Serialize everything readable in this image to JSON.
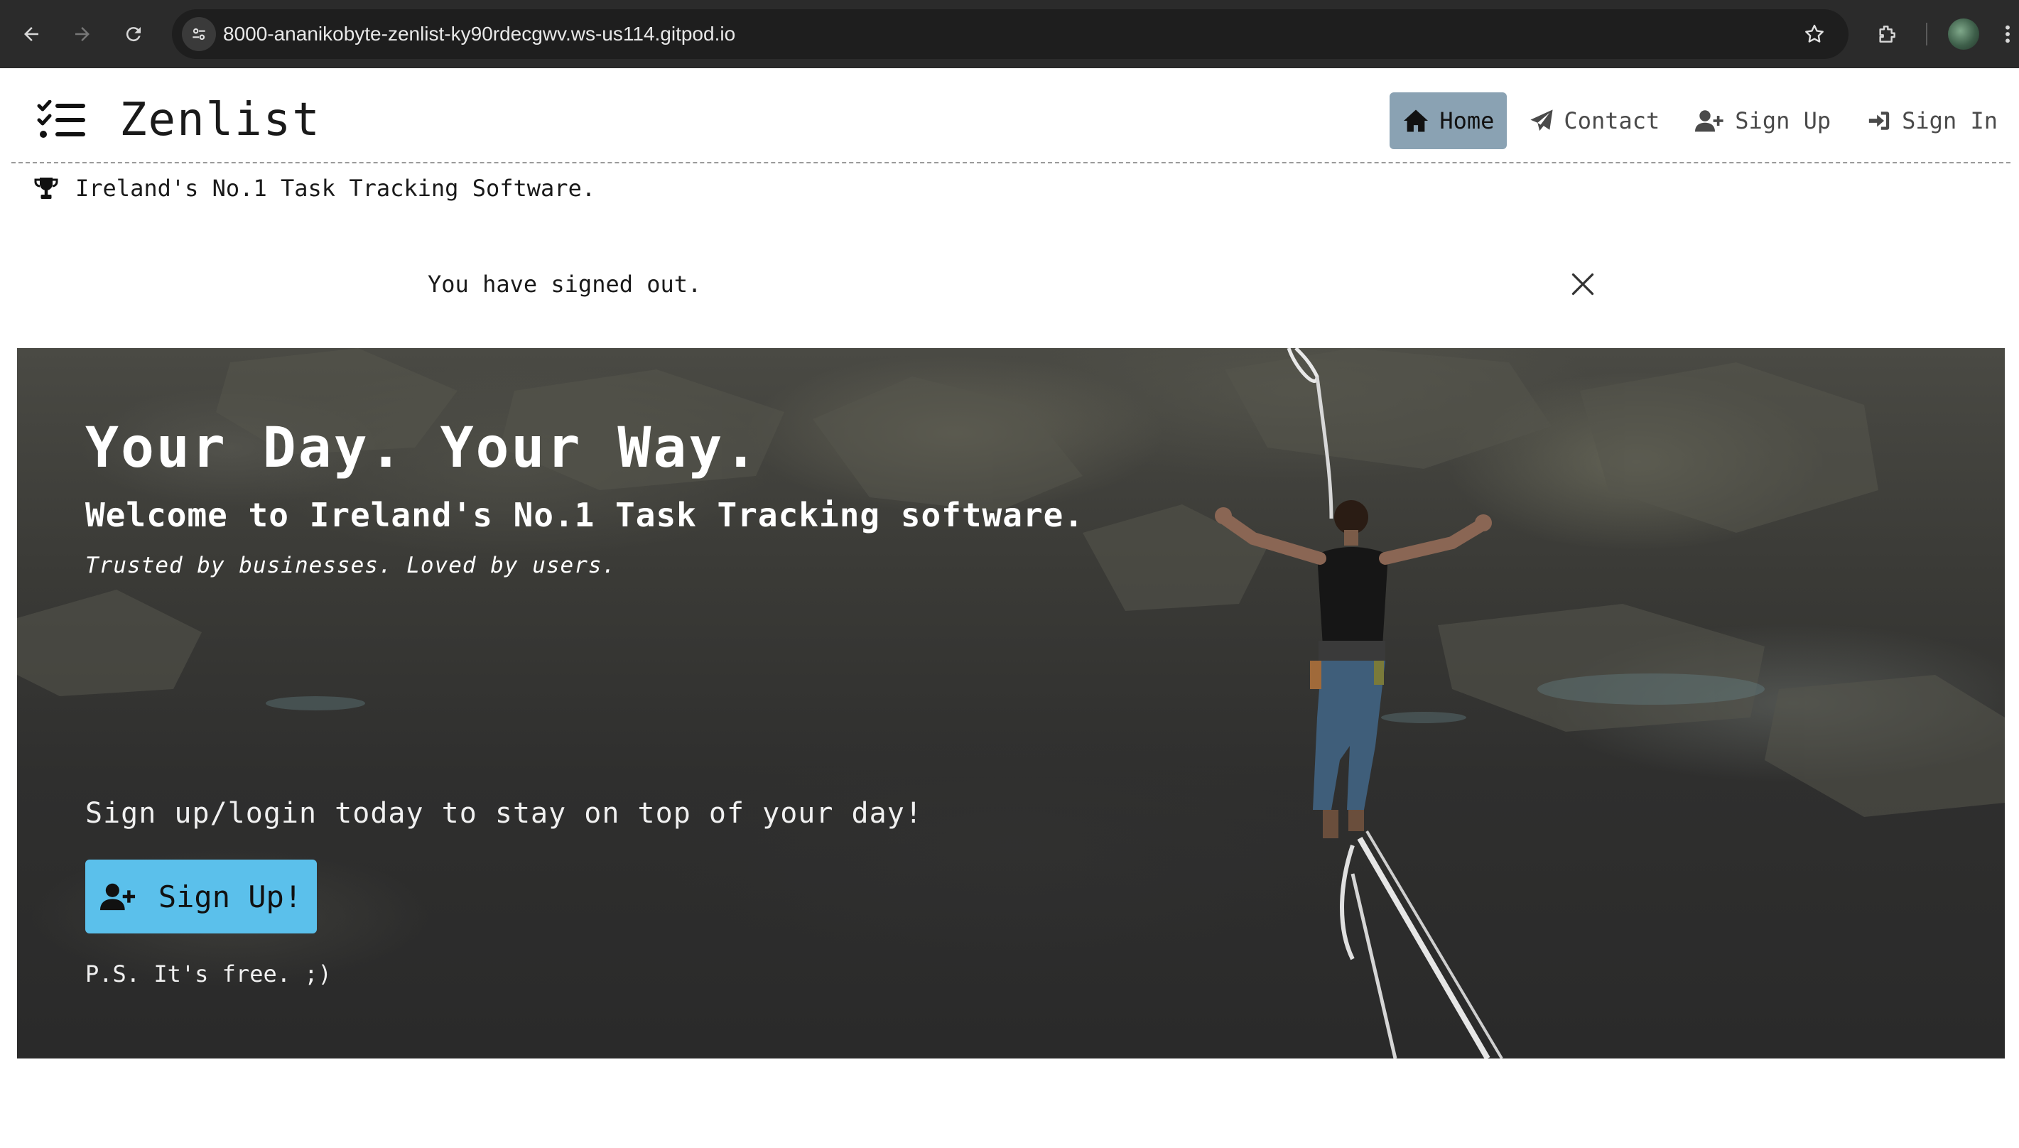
{
  "browser": {
    "url": "8000-ananikobyte-zenlist-ky90rdecgwv.ws-us114.gitpod.io",
    "icons": [
      "back-icon",
      "forward-icon",
      "reload-icon",
      "site-settings-icon",
      "bookmark-star-icon",
      "extensions-icon",
      "profile-avatar",
      "more-menu-icon"
    ]
  },
  "navbar": {
    "brand": "Zenlist",
    "brand_icon": "checklist-icon",
    "items": [
      {
        "label": "Home",
        "icon": "home-icon",
        "active": true
      },
      {
        "label": "Contact",
        "icon": "paper-plane-icon",
        "active": false
      },
      {
        "label": "Sign Up",
        "icon": "user-plus-icon",
        "active": false
      },
      {
        "label": "Sign In",
        "icon": "sign-in-icon",
        "active": false
      }
    ]
  },
  "tagline": {
    "icon": "trophy-icon",
    "text": "Ireland's No.1 Task Tracking Software."
  },
  "alert": {
    "message": "You have signed out.",
    "close_icon": "close-icon"
  },
  "hero": {
    "title": "Your Day. Your Way.",
    "subtitle": "Welcome to Ireland's No.1 Task Tracking software.",
    "trusted": "Trusted by businesses. Loved by users.",
    "cta_text": "Sign up/login today to stay on top of your day!",
    "button_label": "Sign Up!",
    "ps": "P.S. It's free. ;)"
  },
  "colors": {
    "active_nav": "#8aa2b3",
    "cta_button": "#5bc0eb",
    "browser_chrome": "#2b2b2b"
  }
}
